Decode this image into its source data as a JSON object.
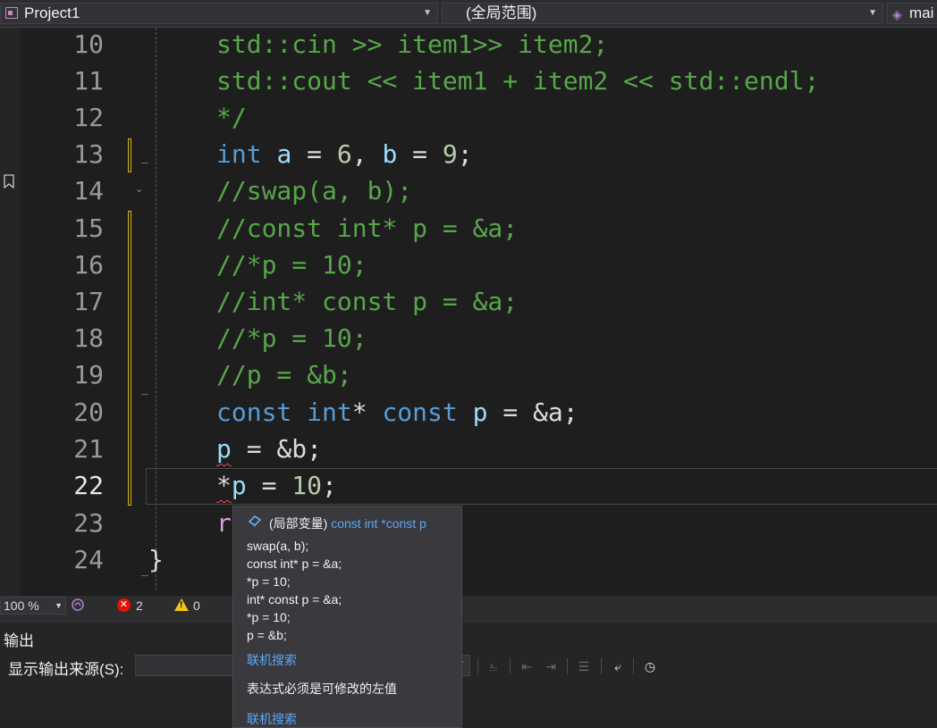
{
  "navbar": {
    "project": "Project1",
    "scope": "(全局范围)",
    "member": "mai"
  },
  "editor": {
    "lines": [
      {
        "num": "10",
        "text": "std::cin >> item1>> item2;"
      },
      {
        "num": "11",
        "text": "std::cout << item1 + item2 << std::endl;"
      },
      {
        "num": "12",
        "text": "*/"
      },
      {
        "num": "13",
        "text": "int a = 6, b = 9;"
      },
      {
        "num": "14",
        "text": "//swap(a, b);"
      },
      {
        "num": "15",
        "text": "//const int* p = &a;"
      },
      {
        "num": "16",
        "text": "//*p = 10;"
      },
      {
        "num": "17",
        "text": "//int* const p = &a;"
      },
      {
        "num": "18",
        "text": "//*p = 10;"
      },
      {
        "num": "19",
        "text": "//p = &b;"
      },
      {
        "num": "20",
        "text": "const int* const p = &a;"
      },
      {
        "num": "21",
        "text": "p = &b;"
      },
      {
        "num": "22",
        "text": "*p = 10;"
      },
      {
        "num": "23",
        "text": "r"
      },
      {
        "num": "24",
        "text": "}"
      }
    ],
    "current_line": "22",
    "tokens": {
      "l13_kw": "int",
      "l13_a": "a",
      "l13_eq1": " = ",
      "l13_n1": "6",
      "l13_sep": ", ",
      "l13_b": "b",
      "l13_eq2": " = ",
      "l13_n2": "9",
      "l13_end": ";",
      "l20_const1": "const",
      "l20_int": "int",
      "l20_star": "* ",
      "l20_const2": "const",
      "l20_p": "p",
      "l20_rest": " = &a;",
      "l21_p": "p",
      "l21_rest": " = &b;",
      "l22_star": "*",
      "l22_p": "p",
      "l22_eq": " = ",
      "l22_n": "10",
      "l22_end": ";",
      "l23_r": "r"
    }
  },
  "statusbar": {
    "zoom": "100 %",
    "errors": "2",
    "warnings": "0"
  },
  "output": {
    "title": "输出",
    "source_label": "显示输出来源(S):",
    "source_value": ""
  },
  "tooltip": {
    "kind": "(局部变量)",
    "type_a": "const int *const",
    "name": "p",
    "comment_lines": [
      "swap(a, b);",
      "const int* p = &a;",
      "*p = 10;",
      "int* const p = &a;",
      "*p = 10;",
      "p = &b;"
    ],
    "link1": "联机搜索",
    "error_message": "表达式必须是可修改的左值",
    "link2": "联机搜索"
  },
  "colors": {
    "keyword": "#569cd6",
    "comment": "#57a64a",
    "number": "#b5cea8",
    "variable": "#9cdcfe",
    "control": "#d8a0df",
    "link": "#5ba7f7",
    "error": "#e51400",
    "warning": "#f0c419"
  },
  "icons": {
    "project": "project-icon",
    "member": "cube-icon",
    "bookmark": "bookmark-icon",
    "error": "error-icon",
    "warning": "warning-icon",
    "variable": "local-variable-icon"
  }
}
